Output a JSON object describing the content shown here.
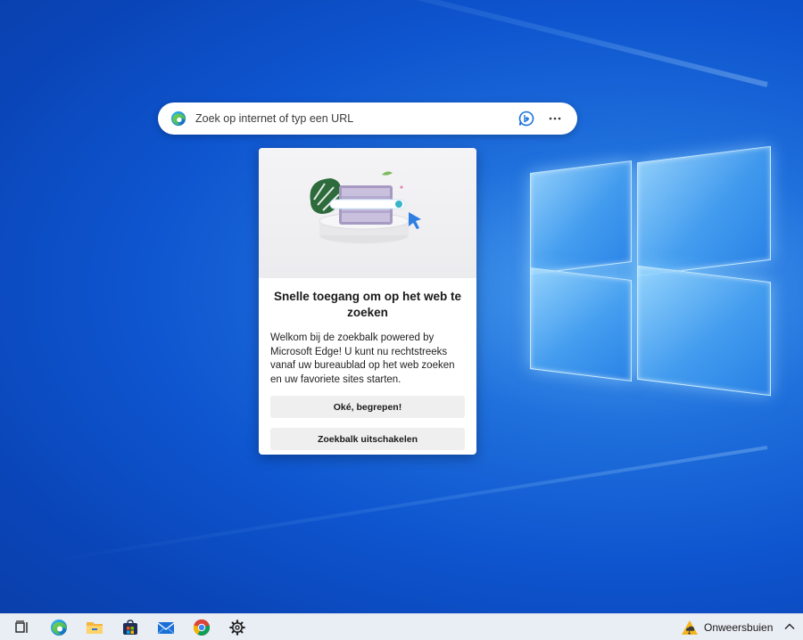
{
  "search_bar": {
    "placeholder": "Zoek op internet of typ een URL",
    "icons": [
      "edge-icon",
      "bing-chat-icon",
      "more-options-icon"
    ]
  },
  "popup": {
    "title": "Snelle toegang om op het web te zoeken",
    "body": "Welkom bij de zoekbalk powered by Microsoft Edge! U kunt nu rechtstreeks vanaf uw bureaublad op het web zoeken en uw favoriete sites starten.",
    "ok_label": "Oké, begrepen!",
    "disable_label": "Zoekbalk uitschakelen"
  },
  "taskbar": {
    "icons": [
      "task-view-icon",
      "edge-icon",
      "file-explorer-icon",
      "store-icon",
      "mail-icon",
      "chrome-icon",
      "settings-icon"
    ],
    "weather_label": "Onweersbuien",
    "weather_icon": "storm-warning-icon"
  },
  "colors": {
    "desktop_blue": "#0e55cf",
    "accent": "#0078d4",
    "taskbar": "#e9edf4",
    "button_bg": "#efefef"
  }
}
